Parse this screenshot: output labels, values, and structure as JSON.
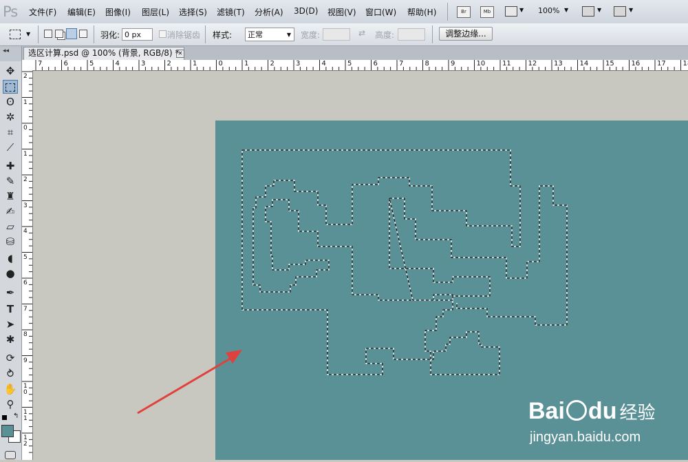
{
  "app": {
    "logo": "Ps"
  },
  "menu": [
    "文件(F)",
    "编辑(E)",
    "图像(I)",
    "图层(L)",
    "选择(S)",
    "滤镜(T)",
    "分析(A)",
    "3D(D)",
    "视图(V)",
    "窗口(W)",
    "帮助(H)"
  ],
  "top_right": {
    "br": "Br",
    "mb": "Mb",
    "zoom": "100%"
  },
  "options": {
    "feather_label": "羽化:",
    "feather_value": "0 px",
    "antialias_label": "消除锯齿",
    "style_label": "样式:",
    "style_value": "正常",
    "width_label": "宽度:",
    "height_label": "高度:",
    "refine_edge": "调整边缘..."
  },
  "document": {
    "tab_title": "选区计算.psd @ 100% (背景, RGB/8) *"
  },
  "ruler": {
    "top": [
      "7",
      "6",
      "5",
      "4",
      "3",
      "2",
      "1",
      "0",
      "1",
      "2",
      "3",
      "4",
      "5",
      "6",
      "7",
      "8",
      "9",
      "10",
      "11",
      "12",
      "13",
      "14",
      "15",
      "16",
      "17",
      "18"
    ],
    "left": [
      "2",
      "1",
      "0",
      "1",
      "2",
      "3",
      "4",
      "5",
      "6",
      "7",
      "8",
      "9",
      "10",
      "11",
      "12"
    ]
  },
  "colors": {
    "foreground": "#5a9197",
    "background": "#ffffff",
    "canvas": "#5a9197",
    "arrow": "#e0413c"
  },
  "watermark": {
    "brand_bai": "Bai",
    "brand_du": "du",
    "brand_cn": "经验",
    "url": "jingyan.baidu.com"
  },
  "tools": [
    "move-icon",
    "marquee-icon",
    "lasso-icon",
    "magic-wand-icon",
    "crop-icon",
    "eyedropper-icon",
    "healing-icon",
    "brush-icon",
    "stamp-icon",
    "history-brush-icon",
    "eraser-icon",
    "bucket-icon",
    "blur-icon",
    "dodge-icon",
    "pen-icon",
    "type-icon",
    "path-select-icon",
    "shape-icon",
    "3d-rotate-icon",
    "3d-orbit-icon",
    "hand-icon",
    "zoom-icon"
  ]
}
